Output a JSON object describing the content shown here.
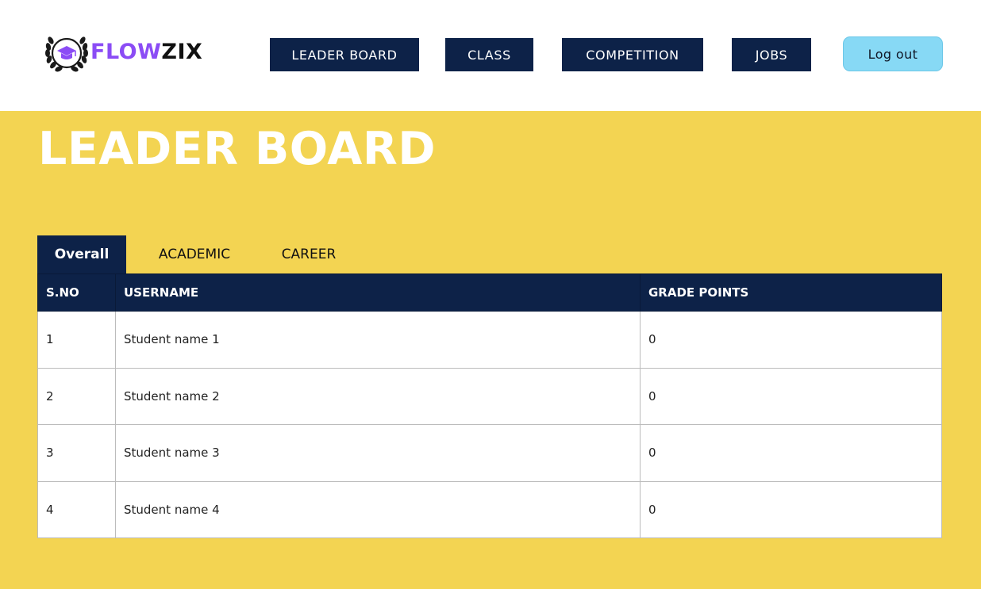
{
  "brand": {
    "name_part1": "FLOW",
    "name_part2": "ZIX",
    "purple": "#8b4cf5",
    "icon": "graduation-cap-laurel-icon"
  },
  "nav": {
    "items": [
      {
        "label": "LEADER BOARD"
      },
      {
        "label": "CLASS"
      },
      {
        "label": "COMPETITION"
      },
      {
        "label": "JOBS"
      }
    ],
    "logout_label": "Log out"
  },
  "page": {
    "title": "LEADER BOARD"
  },
  "tabs": [
    {
      "label": "Overall",
      "active": true
    },
    {
      "label": "ACADEMIC",
      "active": false
    },
    {
      "label": "CAREER",
      "active": false
    }
  ],
  "table": {
    "headers": [
      "S.NO",
      "USERNAME",
      "GRADE POINTS"
    ],
    "rows": [
      [
        "1",
        "Student name 1",
        "0"
      ],
      [
        "2",
        "Student name 2",
        "0"
      ],
      [
        "3",
        "Student name 3",
        "0"
      ],
      [
        "4",
        "Student name 4",
        "0"
      ]
    ]
  },
  "colors": {
    "navy": "#0d2248",
    "background_yellow": "#f3d452",
    "logout_blue": "#87d9f5"
  }
}
